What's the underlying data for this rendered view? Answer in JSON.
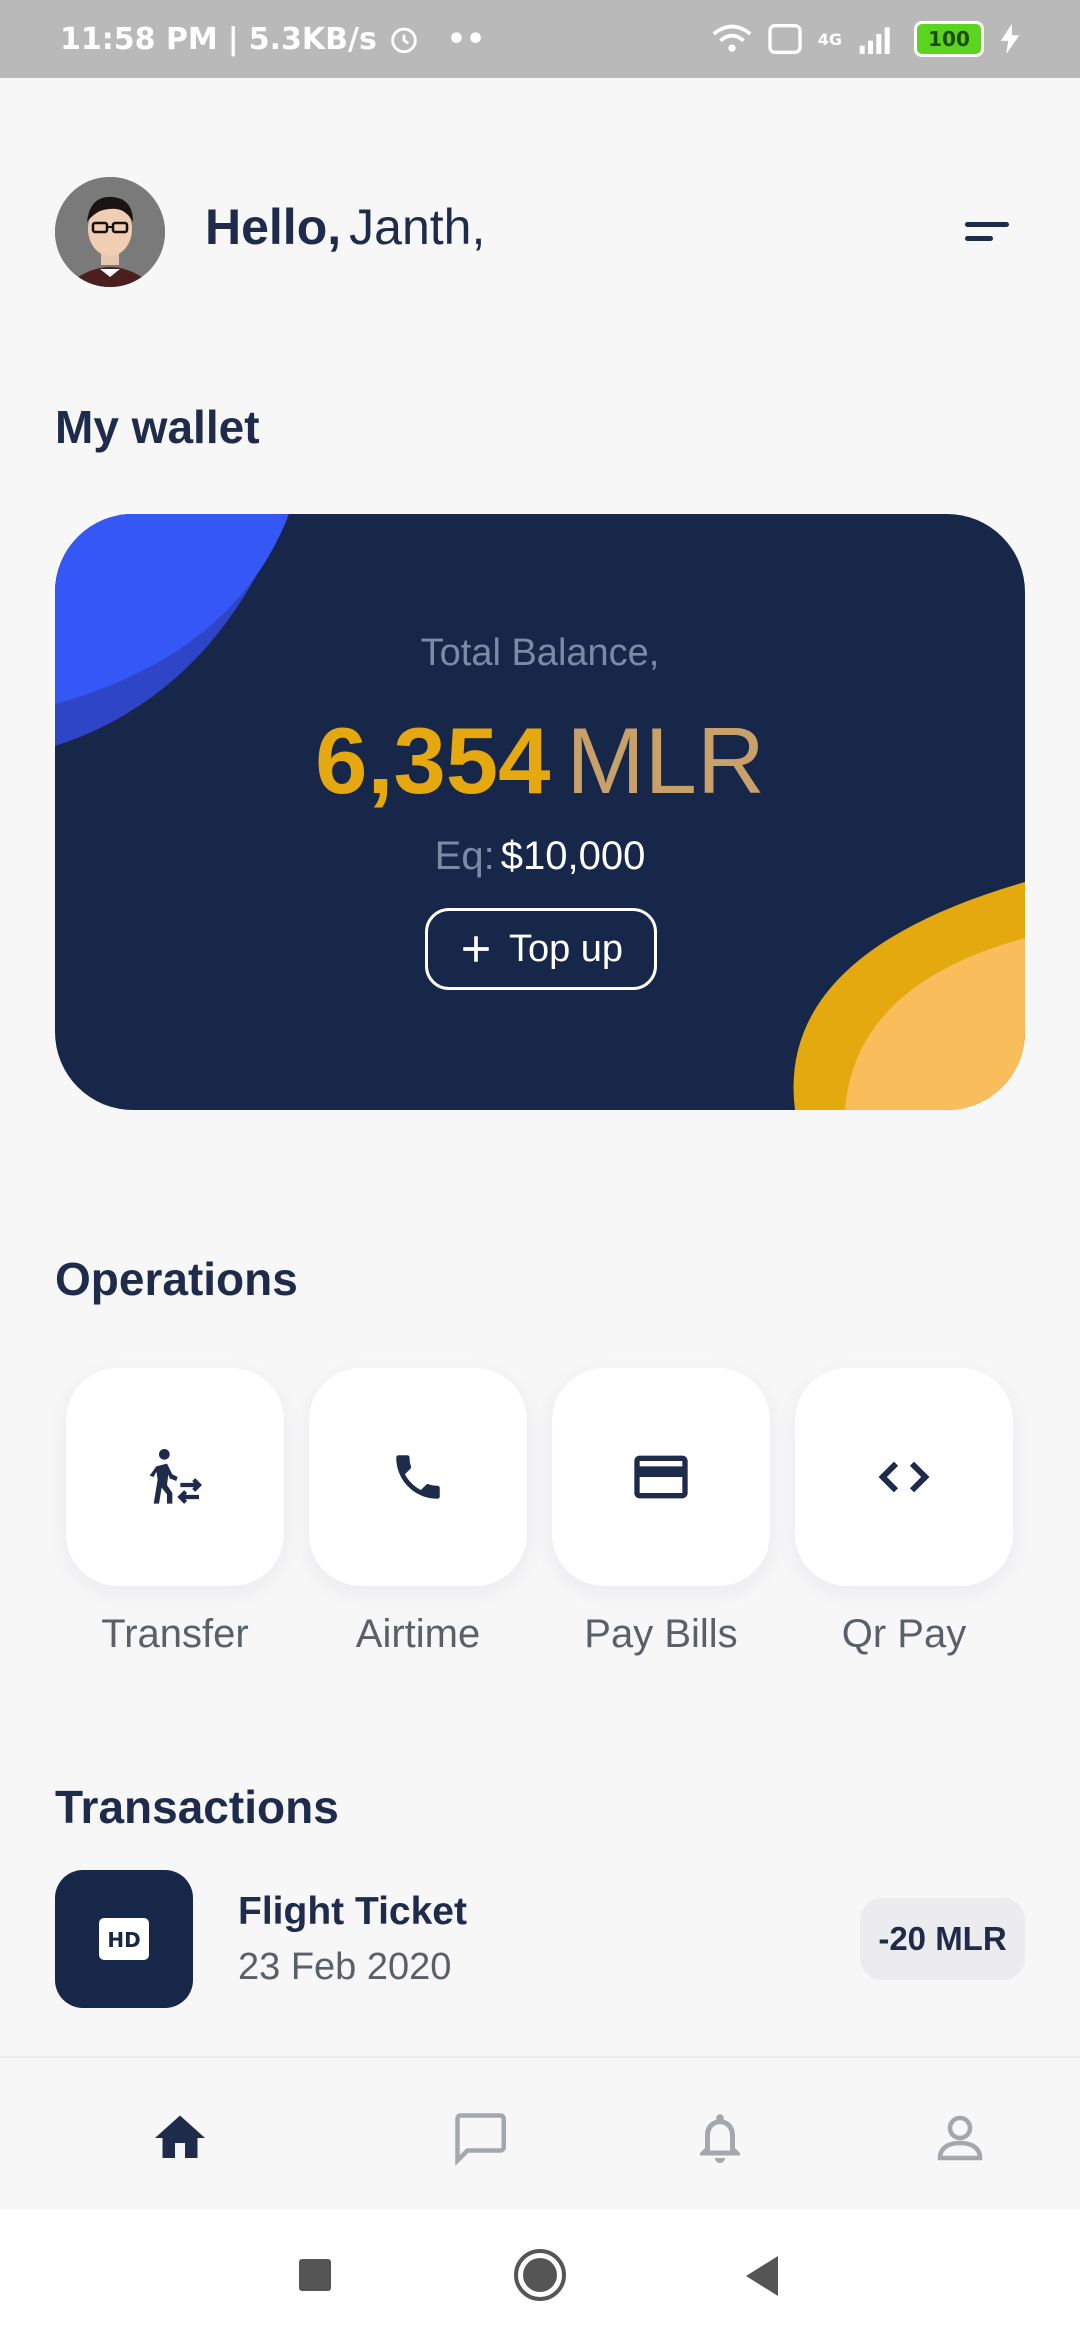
{
  "status_bar": {
    "time": "11:58 PM",
    "speed": "5.3KB/s",
    "dots": "••",
    "network": "4G",
    "battery": "100"
  },
  "header": {
    "greeting": "Hello,",
    "name": "Janth,"
  },
  "wallet": {
    "title": "My wallet",
    "balance_label": "Total Balance,",
    "amount": "6,354",
    "unit": "MLR",
    "eq_label": "Eq:",
    "eq_value": "$10,000",
    "topup_label": "Top up"
  },
  "operations": {
    "title": "Operations",
    "items": [
      {
        "label": "Transfer",
        "icon": "transfer-icon"
      },
      {
        "label": "Airtime",
        "icon": "phone-icon"
      },
      {
        "label": "Pay Bills",
        "icon": "credit-card-icon"
      },
      {
        "label": "Qr Pay",
        "icon": "code-icon"
      }
    ]
  },
  "transactions": {
    "title": "Transactions",
    "items": [
      {
        "title": "Flight Ticket",
        "date": "23 Feb 2020",
        "amount": "-20 MLR",
        "icon": "hd-icon",
        "icon_text": "HD"
      }
    ]
  },
  "bottom_nav": {
    "items": [
      "home-icon",
      "chat-icon",
      "bell-icon",
      "profile-icon"
    ],
    "active": "home-icon"
  },
  "colors": {
    "navy": "#17274a",
    "gold": "#e6a80f",
    "blue_accent": "#3555f5",
    "text_dark": "#1e2b4a"
  }
}
